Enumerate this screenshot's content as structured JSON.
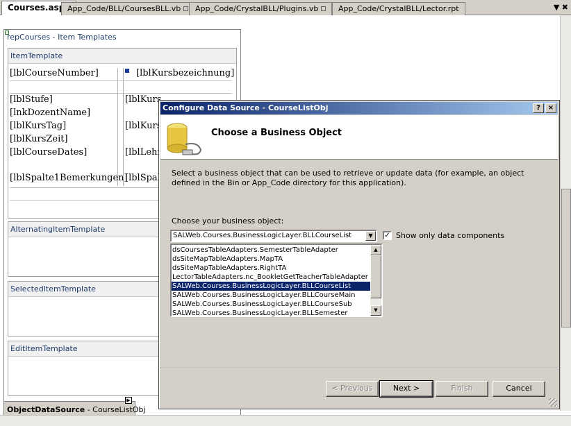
{
  "tabs": [
    {
      "label": "Courses.aspx",
      "active": true,
      "locked": false
    },
    {
      "label": "App_Code/BLL/CoursesBLL.vb",
      "active": false,
      "locked": true
    },
    {
      "label": "App_Code/CrystalBLL/Plugins.vb",
      "active": false,
      "locked": true
    },
    {
      "label": "App_Code/CrystalBLL/Lector.rpt",
      "active": false,
      "locked": false
    }
  ],
  "tab_menu_glyph": "▼ ✖",
  "designer": {
    "repeater_title": "repCourses - Item Templates",
    "templates": {
      "item": "ItemTemplate",
      "alternating": "AlternatingItemTemplate",
      "selected": "SelectedItemTemplate",
      "edit": "EditItemTemplate"
    },
    "labels": {
      "course_number": "[lblCourseNumber]",
      "kursbezeichnung": "[lblKursbezeichnung]",
      "stufe": "[lblStufe]",
      "dozent": "[lnkDozentName]",
      "kurstag": "[lblKursTag]",
      "kurszeit": "[lblKursZeit]",
      "course_dates": "[lblCourseDates]",
      "spalte1": "[lblSpalte1Bemerkungen]",
      "right_kurs1": "[lblKurs",
      "right_kurs2": "[lblKurs",
      "right_lehr": "[lblLehr",
      "right_spal": "[lblSpal"
    },
    "ods_label_bold": "ObjectDataSource",
    "ods_label_rest": " - CourseListObj"
  },
  "dialog": {
    "title": "Configure Data Source - CourseListObj",
    "help_glyph": "?",
    "close_glyph": "×",
    "header": "Choose a Business Object",
    "description": "Select a business object that can be used to retrieve or update data (for example, an object defined in the Bin or App_Code directory for this application).",
    "choose_label": "Choose your business object:",
    "selected_object": "SALWeb.Courses.BusinessLogicLayer.BLLCourseList",
    "show_only_label": "Show only data components",
    "show_only_checked": true,
    "list_items": [
      {
        "text": "dsCoursesTableAdapters.SemesterTableAdapter",
        "selected": false
      },
      {
        "text": "dsSiteMapTableAdapters.MapTA",
        "selected": false
      },
      {
        "text": "dsSiteMapTableAdapters.RightTA",
        "selected": false
      },
      {
        "text": "LectorTableAdapters.nc_BookletGetTeacherTableAdapter",
        "selected": false
      },
      {
        "text": "SALWeb.Courses.BusinessLogicLayer.BLLCourseList",
        "selected": true
      },
      {
        "text": "SALWeb.Courses.BusinessLogicLayer.BLLCourseMain",
        "selected": false
      },
      {
        "text": "SALWeb.Courses.BusinessLogicLayer.BLLCourseSub",
        "selected": false
      },
      {
        "text": "SALWeb.Courses.BusinessLogicLayer.BLLSemester",
        "selected": false
      }
    ],
    "buttons": {
      "previous": "< Previous",
      "next": "Next >",
      "finish": "Finish",
      "cancel": "Cancel"
    }
  },
  "colors": {
    "title_bar_start": "#0a246a",
    "title_bar_end": "#a6caf0",
    "selection": "#0a246a",
    "dialog_face": "#d4d0c8",
    "template_header_text": "#1f3c6b"
  }
}
